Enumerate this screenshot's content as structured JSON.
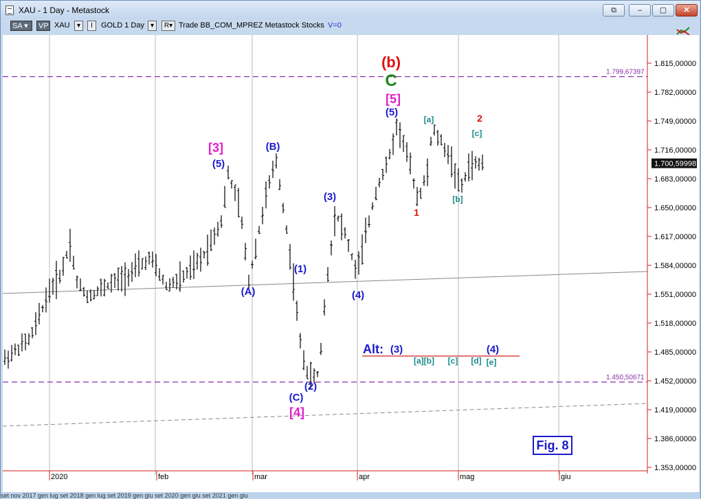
{
  "window": {
    "title": "XAU - 1 Day - Metastock",
    "buttons": {
      "restore_all": "⧉",
      "minimize": "–",
      "maximize": "▢",
      "close": "✕"
    }
  },
  "toolbar": {
    "sa": "SA",
    "vp": "VP",
    "symbol": "XAU",
    "i_box": "I",
    "gold_period": "GOLD 1 Day",
    "r_box": "R",
    "trade_text": "Trade BB_COM_MPREZ Metastock Stocks",
    "v": "V=0"
  },
  "colors": {
    "bar": "#000000",
    "blue_label": "#1a1acc",
    "magenta_label": "#e020c8",
    "red_label": "#e01010",
    "green_label": "#1a8a1a",
    "teal_label": "#1a8a8a",
    "fib_line": "#8b2fa8",
    "axis_red": "#d22020"
  },
  "y_axis": {
    "ticks": [
      "1.815,00000",
      "1.782,00000",
      "1.749,00000",
      "1.716,00000",
      "1.683,00000",
      "1.650,00000",
      "1.617,00000",
      "1.584,00000",
      "1.551,00000",
      "1.518,00000",
      "1.485,00000",
      "1.452,00000",
      "1.419,00000",
      "1.386,00000",
      "1.353,00000"
    ],
    "last_price": "1.700,59998"
  },
  "x_axis": {
    "labels": [
      "2020",
      "feb",
      "mar",
      "apr",
      "mag",
      "giu"
    ]
  },
  "levels": {
    "upper": "1.799,67397",
    "lower": "1.450,50671"
  },
  "labels": {
    "b_paren": "(b)",
    "c_big": "C",
    "five_bracket_top": "[5]",
    "five_paren_top": "(5)",
    "a_bracket": "[a]",
    "two_red": "2",
    "c_bracket_top": "[c]",
    "b_bracket": "[b]",
    "one_red": "1",
    "three_bracket": "[3]",
    "five_paren_left": "(5)",
    "B_paren": "(B)",
    "three_paren": "(3)",
    "one_paren": "(1)",
    "A_paren": "(A)",
    "four_paren": "(4)",
    "two_paren": "(2)",
    "C_paren": "(C)",
    "four_bracket": "[4]",
    "alt": "Alt:",
    "alt_three": "(3)",
    "alt_four": "(4)",
    "alt_ab": "[a][b]",
    "alt_c": "[c]",
    "alt_d": "[d]",
    "alt_e": "[e]",
    "fig": "Fig. 8"
  },
  "bottom_strip": "set  nov 2017  gen  lug  set  2018  gen  lug  set  2019  gen  giu  set  2020  gen  giu  set  2021  gen  giu"
}
